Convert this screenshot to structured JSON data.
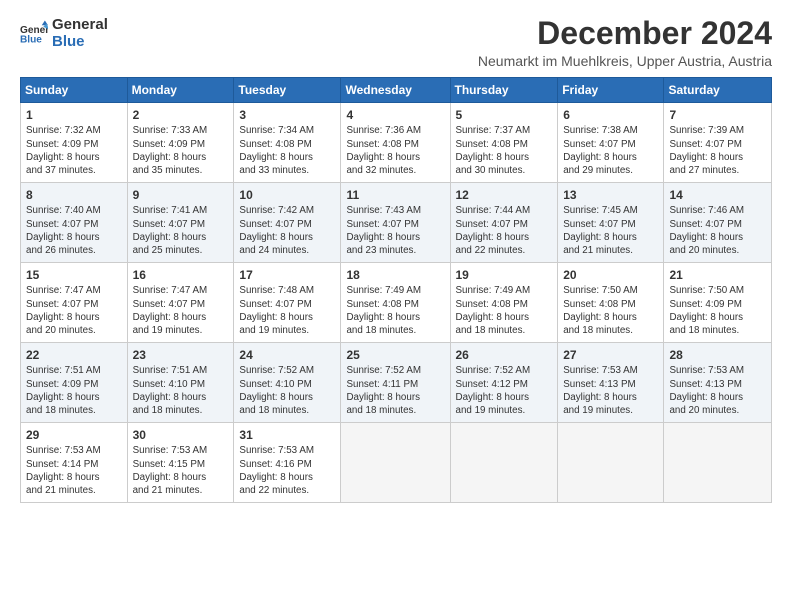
{
  "logo": {
    "line1": "General",
    "line2": "Blue"
  },
  "title": "December 2024",
  "location": "Neumarkt im Muehlkreis, Upper Austria, Austria",
  "weekdays": [
    "Sunday",
    "Monday",
    "Tuesday",
    "Wednesday",
    "Thursday",
    "Friday",
    "Saturday"
  ],
  "weeks": [
    [
      {
        "day": "1",
        "info": "Sunrise: 7:32 AM\nSunset: 4:09 PM\nDaylight: 8 hours\nand 37 minutes."
      },
      {
        "day": "2",
        "info": "Sunrise: 7:33 AM\nSunset: 4:09 PM\nDaylight: 8 hours\nand 35 minutes."
      },
      {
        "day": "3",
        "info": "Sunrise: 7:34 AM\nSunset: 4:08 PM\nDaylight: 8 hours\nand 33 minutes."
      },
      {
        "day": "4",
        "info": "Sunrise: 7:36 AM\nSunset: 4:08 PM\nDaylight: 8 hours\nand 32 minutes."
      },
      {
        "day": "5",
        "info": "Sunrise: 7:37 AM\nSunset: 4:08 PM\nDaylight: 8 hours\nand 30 minutes."
      },
      {
        "day": "6",
        "info": "Sunrise: 7:38 AM\nSunset: 4:07 PM\nDaylight: 8 hours\nand 29 minutes."
      },
      {
        "day": "7",
        "info": "Sunrise: 7:39 AM\nSunset: 4:07 PM\nDaylight: 8 hours\nand 27 minutes."
      }
    ],
    [
      {
        "day": "8",
        "info": "Sunrise: 7:40 AM\nSunset: 4:07 PM\nDaylight: 8 hours\nand 26 minutes."
      },
      {
        "day": "9",
        "info": "Sunrise: 7:41 AM\nSunset: 4:07 PM\nDaylight: 8 hours\nand 25 minutes."
      },
      {
        "day": "10",
        "info": "Sunrise: 7:42 AM\nSunset: 4:07 PM\nDaylight: 8 hours\nand 24 minutes."
      },
      {
        "day": "11",
        "info": "Sunrise: 7:43 AM\nSunset: 4:07 PM\nDaylight: 8 hours\nand 23 minutes."
      },
      {
        "day": "12",
        "info": "Sunrise: 7:44 AM\nSunset: 4:07 PM\nDaylight: 8 hours\nand 22 minutes."
      },
      {
        "day": "13",
        "info": "Sunrise: 7:45 AM\nSunset: 4:07 PM\nDaylight: 8 hours\nand 21 minutes."
      },
      {
        "day": "14",
        "info": "Sunrise: 7:46 AM\nSunset: 4:07 PM\nDaylight: 8 hours\nand 20 minutes."
      }
    ],
    [
      {
        "day": "15",
        "info": "Sunrise: 7:47 AM\nSunset: 4:07 PM\nDaylight: 8 hours\nand 20 minutes."
      },
      {
        "day": "16",
        "info": "Sunrise: 7:47 AM\nSunset: 4:07 PM\nDaylight: 8 hours\nand 19 minutes."
      },
      {
        "day": "17",
        "info": "Sunrise: 7:48 AM\nSunset: 4:07 PM\nDaylight: 8 hours\nand 19 minutes."
      },
      {
        "day": "18",
        "info": "Sunrise: 7:49 AM\nSunset: 4:08 PM\nDaylight: 8 hours\nand 18 minutes."
      },
      {
        "day": "19",
        "info": "Sunrise: 7:49 AM\nSunset: 4:08 PM\nDaylight: 8 hours\nand 18 minutes."
      },
      {
        "day": "20",
        "info": "Sunrise: 7:50 AM\nSunset: 4:08 PM\nDaylight: 8 hours\nand 18 minutes."
      },
      {
        "day": "21",
        "info": "Sunrise: 7:50 AM\nSunset: 4:09 PM\nDaylight: 8 hours\nand 18 minutes."
      }
    ],
    [
      {
        "day": "22",
        "info": "Sunrise: 7:51 AM\nSunset: 4:09 PM\nDaylight: 8 hours\nand 18 minutes."
      },
      {
        "day": "23",
        "info": "Sunrise: 7:51 AM\nSunset: 4:10 PM\nDaylight: 8 hours\nand 18 minutes."
      },
      {
        "day": "24",
        "info": "Sunrise: 7:52 AM\nSunset: 4:10 PM\nDaylight: 8 hours\nand 18 minutes."
      },
      {
        "day": "25",
        "info": "Sunrise: 7:52 AM\nSunset: 4:11 PM\nDaylight: 8 hours\nand 18 minutes."
      },
      {
        "day": "26",
        "info": "Sunrise: 7:52 AM\nSunset: 4:12 PM\nDaylight: 8 hours\nand 19 minutes."
      },
      {
        "day": "27",
        "info": "Sunrise: 7:53 AM\nSunset: 4:13 PM\nDaylight: 8 hours\nand 19 minutes."
      },
      {
        "day": "28",
        "info": "Sunrise: 7:53 AM\nSunset: 4:13 PM\nDaylight: 8 hours\nand 20 minutes."
      }
    ],
    [
      {
        "day": "29",
        "info": "Sunrise: 7:53 AM\nSunset: 4:14 PM\nDaylight: 8 hours\nand 21 minutes."
      },
      {
        "day": "30",
        "info": "Sunrise: 7:53 AM\nSunset: 4:15 PM\nDaylight: 8 hours\nand 21 minutes."
      },
      {
        "day": "31",
        "info": "Sunrise: 7:53 AM\nSunset: 4:16 PM\nDaylight: 8 hours\nand 22 minutes."
      },
      {
        "day": "",
        "info": ""
      },
      {
        "day": "",
        "info": ""
      },
      {
        "day": "",
        "info": ""
      },
      {
        "day": "",
        "info": ""
      }
    ]
  ]
}
